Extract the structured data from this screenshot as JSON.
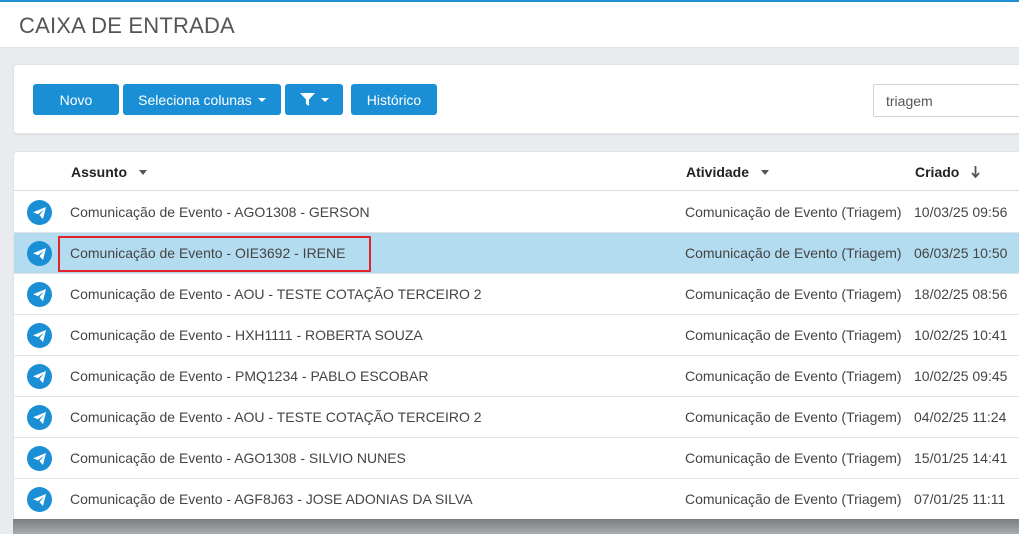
{
  "header": {
    "title": "CAIXA DE ENTRADA"
  },
  "toolbar": {
    "new_label": "Novo",
    "columns_label": "Seleciona colunas",
    "filter_icon": "filter-icon",
    "history_label": "Histórico",
    "search_value": "triagem"
  },
  "colors": {
    "accent": "#1a8fd5",
    "selected_row": "#b3dcf0",
    "highlight": "#e0242b"
  },
  "table": {
    "columns": {
      "subject": "Assunto",
      "activity": "Atividade",
      "created": "Criado"
    },
    "row_icon": "paper-plane-icon",
    "rows": [
      {
        "subject": "Comunicação de Evento - AGO1308 - GERSON",
        "activity": "Comunicação de Evento (Triagem)",
        "created": "10/03/25 09:56"
      },
      {
        "subject": "Comunicação de Evento - OIE3692 - IRENE",
        "activity": "Comunicação de Evento (Triagem)",
        "created": "06/03/25 10:50",
        "selected": true
      },
      {
        "subject": "Comunicação de Evento - AOU - TESTE COTAÇÃO TERCEIRO 2",
        "activity": "Comunicação de Evento (Triagem)",
        "created": "18/02/25 08:56"
      },
      {
        "subject": "Comunicação de Evento - HXH1111 - ROBERTA SOUZA",
        "activity": "Comunicação de Evento (Triagem)",
        "created": "10/02/25 10:41"
      },
      {
        "subject": "Comunicação de Evento - PMQ1234 - PABLO ESCOBAR",
        "activity": "Comunicação de Evento (Triagem)",
        "created": "10/02/25 09:45"
      },
      {
        "subject": "Comunicação de Evento - AOU - TESTE COTAÇÃO TERCEIRO 2",
        "activity": "Comunicação de Evento (Triagem)",
        "created": "04/02/25 11:24"
      },
      {
        "subject": "Comunicação de Evento - AGO1308 - SILVIO NUNES",
        "activity": "Comunicação de Evento (Triagem)",
        "created": "15/01/25 14:41"
      },
      {
        "subject": "Comunicação de Evento - AGF8J63 - JOSE ADONIAS DA SILVA",
        "activity": "Comunicação de Evento (Triagem)",
        "created": "07/01/25 11:11"
      }
    ]
  }
}
